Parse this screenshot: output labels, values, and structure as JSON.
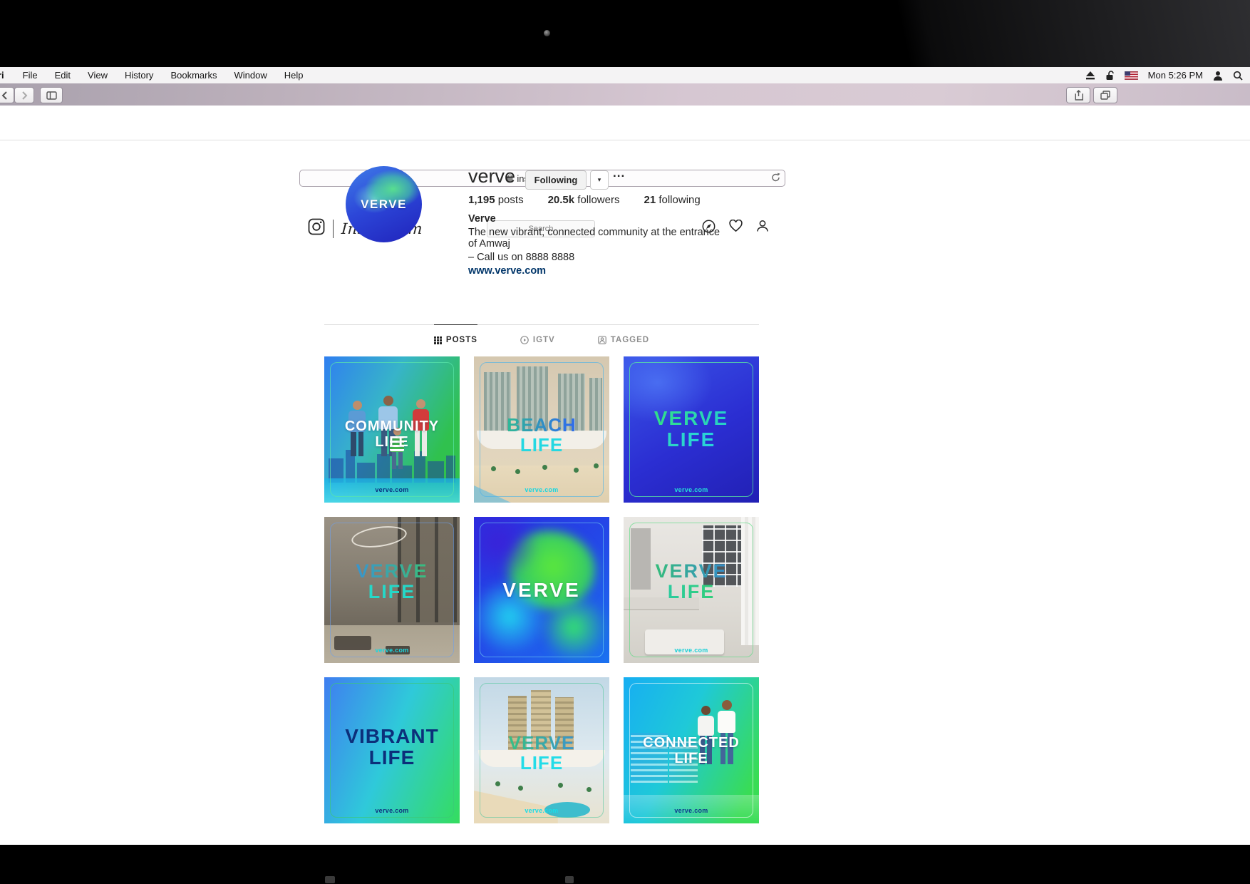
{
  "menubar": {
    "app_partial": "ri",
    "menus": [
      "File",
      "Edit",
      "View",
      "History",
      "Bookmarks",
      "Window",
      "Help"
    ],
    "clock": "Mon 5:26 PM"
  },
  "toolbar": {
    "url": "instagram.com"
  },
  "header": {
    "brand": "Instagram",
    "search_placeholder": "Search"
  },
  "profile": {
    "avatar_text": "VERVE",
    "username": "verve",
    "following_label": "Following",
    "caret": "▾",
    "more_label": "...",
    "stats": [
      {
        "count": "1,195",
        "label": " posts"
      },
      {
        "count": "20.5k",
        "label": " followers"
      },
      {
        "count": "21",
        "label": " following"
      }
    ],
    "bio": {
      "name": "Verve",
      "line1": "The new vibrant, connected community at the entrance of Amwaj",
      "line2": "– Call us on 8888 8888",
      "link": "www.verve.com"
    }
  },
  "tabs": [
    {
      "label": "POSTS",
      "active": true
    },
    {
      "label": "IGTV",
      "active": false
    },
    {
      "label": "TAGGED",
      "active": false
    }
  ],
  "posts": [
    {
      "lines": [
        "COMMUNITY",
        "LIFE"
      ],
      "watermark": "verve.com"
    },
    {
      "lines": [
        "BEACH",
        "LIFE"
      ],
      "watermark": "verve.com"
    },
    {
      "lines": [
        "VERVE",
        "LIFE"
      ],
      "watermark": "verve.com"
    },
    {
      "lines": [
        "VERVE",
        "LIFE"
      ],
      "watermark": "verve.com"
    },
    {
      "lines": [
        "VERVE"
      ],
      "watermark": ""
    },
    {
      "lines": [
        "VERVE",
        "LIFE"
      ],
      "watermark": "verve.com"
    },
    {
      "lines": [
        "VIBRANT",
        "LIFE"
      ],
      "watermark": "verve.com"
    },
    {
      "lines": [
        "VERVE",
        "LIFE"
      ],
      "watermark": "verve.com"
    },
    {
      "lines": [
        "CONNECTED",
        "LIFE"
      ],
      "watermark": "verve.com"
    }
  ],
  "colors": {
    "accent_green": "#35d95c",
    "accent_blue": "#2f6fe8",
    "accent_cyan": "#23d8e0",
    "link_dark": "#003569"
  }
}
